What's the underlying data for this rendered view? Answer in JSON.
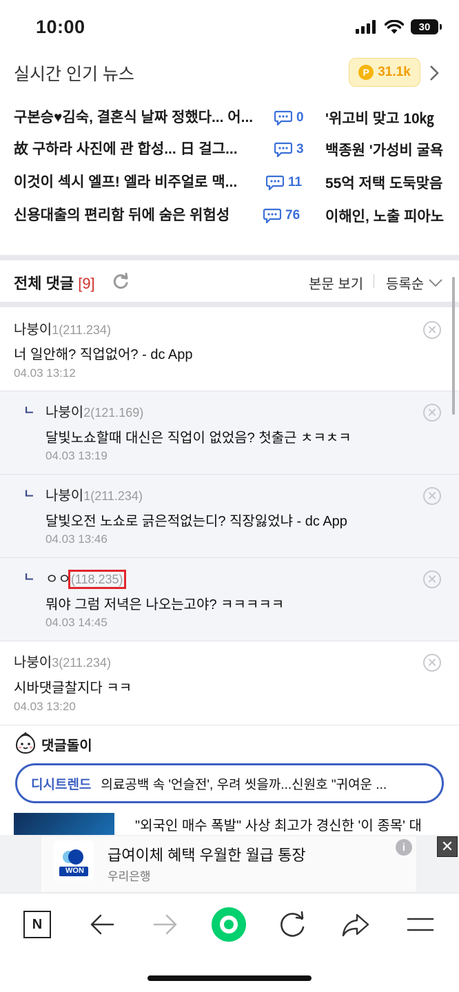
{
  "status_bar": {
    "time": "10:00",
    "battery": "30"
  },
  "header": {
    "title": "실시간 인기 뉴스",
    "points": "31.1k",
    "coin_label": "P"
  },
  "news": [
    {
      "title": "구본승♥김숙, 결혼식 날짜 정했다... 어...",
      "count": "0",
      "right": "'위고비 맞고 10㎏"
    },
    {
      "title": "故 구하라 사진에 관 합성... 日 걸그...",
      "count": "3",
      "right": "백종원 '가성비 굴욕"
    },
    {
      "title": "이것이 섹시 엘프! 엘라 비주얼로 맥...",
      "count": "11",
      "right": "55억 저택 도둑맞음"
    },
    {
      "title": "신용대출의 편리함 뒤에 숨은 위험성",
      "count": "76",
      "right": "이해인, 노출 피아노"
    }
  ],
  "comments_header": {
    "title": "전체 댓글",
    "count": "[9]",
    "view_body": "본문 보기",
    "sort": "등록순"
  },
  "comments": [
    {
      "author": "나붕이",
      "num": "1",
      "ip": "(211.234)",
      "text": "너 일안해? 직업없어? - dc App",
      "date": "04.03 13:12",
      "reply": false
    },
    {
      "author": "나붕이",
      "num": "2",
      "ip": "(121.169)",
      "text": "달빛노쇼할때 대신은 직업이 없었음? 첫출근 ㅊㅋㅊㅋ",
      "date": "04.03 13:19",
      "reply": true
    },
    {
      "author": "나붕이",
      "num": "1",
      "ip": "(211.234)",
      "text": "달빛오전 노쇼로 긁은적없는디? 직장잃었냐 - dc App",
      "date": "04.03 13:46",
      "reply": true
    },
    {
      "author": "ㅇㅇ",
      "num": "",
      "ip": "(118.235)",
      "text": "뭐야 그럼 저녁은 나오는고야? ㅋㅋㅋㅋㅋ",
      "date": "04.03 14:45",
      "reply": true
    },
    {
      "author": "나붕이",
      "num": "3",
      "ip": "(211.234)",
      "text": "시바댓글찰지다 ㅋㅋ",
      "date": "04.03 13:20",
      "reply": false
    }
  ],
  "reply_mark": "ㄴ",
  "bot": {
    "label": "댓글돌이"
  },
  "trend": {
    "tag": "디시트렌드",
    "text": "의료공백 속 '언슬전', 우려 씻을까...신원호 \"귀여운 ..."
  },
  "article": {
    "text": "\"외국인 매수 폭발\" 사상 최고가 경신한 '이 종목' 대"
  },
  "ad": {
    "title": "급여이체 혜택 우월한 월급 통장",
    "sub": "우리은행",
    "logo_text": "WON",
    "info": "i",
    "close": "✕"
  },
  "nav": {
    "n_label": "N"
  }
}
